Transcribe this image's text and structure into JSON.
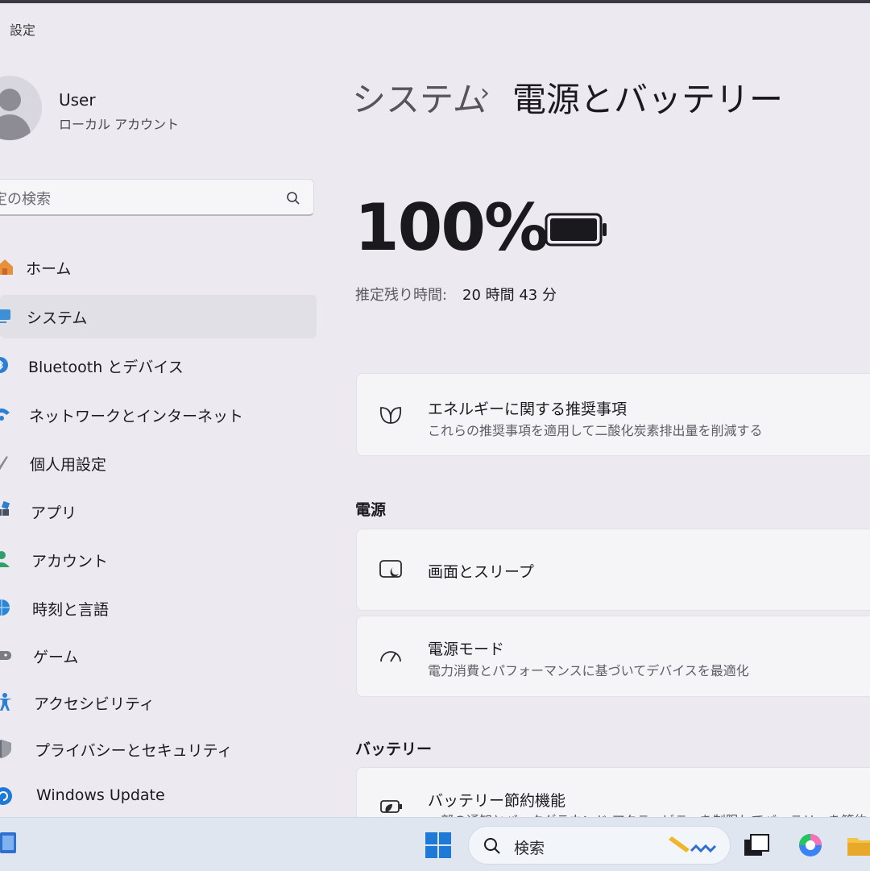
{
  "app_title": "設定",
  "user": {
    "name": "User",
    "account_type": "ローカル アカウント"
  },
  "search": {
    "placeholder": "定の検索"
  },
  "nav": [
    {
      "label": "ホーム",
      "icon": "home-icon"
    },
    {
      "label": "システム",
      "icon": "system-icon",
      "active": true
    },
    {
      "label": "Bluetooth とデバイス",
      "icon": "bluetooth-icon"
    },
    {
      "label": "ネットワークとインターネット",
      "icon": "wifi-icon"
    },
    {
      "label": "個人用設定",
      "icon": "pen-icon"
    },
    {
      "label": "アプリ",
      "icon": "apps-icon"
    },
    {
      "label": "アカウント",
      "icon": "account-icon"
    },
    {
      "label": "時刻と言語",
      "icon": "globe-icon"
    },
    {
      "label": "ゲーム",
      "icon": "gamepad-icon"
    },
    {
      "label": "アクセシビリティ",
      "icon": "accessibility-icon"
    },
    {
      "label": "プライバシーとセキュリティ",
      "icon": "shield-icon"
    },
    {
      "label": "Windows Update",
      "icon": "update-icon"
    }
  ],
  "breadcrumb": {
    "parent": "システム",
    "separator": "›",
    "current": "電源とバッテリー"
  },
  "battery": {
    "percent": "100%",
    "level": 1.0,
    "estimate_label": "推定残り時間:",
    "estimate_value": "20 時間 43 分"
  },
  "energy_card": {
    "title": "エネルギーに関する推奨事項",
    "subtitle": "これらの推奨事項を適用して二酸化炭素排出量を削減する",
    "icon": "leaf-icon"
  },
  "power_section": {
    "heading": "電源",
    "items": [
      {
        "title": "画面とスリープ",
        "icon": "screen-sleep-icon"
      },
      {
        "title": "電源モード",
        "subtitle": "電力消費とパフォーマンスに基づいてデバイスを最適化",
        "icon": "gauge-icon"
      }
    ]
  },
  "battery_section": {
    "heading": "バッテリー",
    "items": [
      {
        "title": "バッテリー節約機能",
        "subtitle": "一部の通知とバックグラウンド アクティビティを制限してバッテリーを節約",
        "icon": "battery-saver-icon"
      }
    ]
  },
  "taskbar": {
    "search_label": "検索",
    "apps": [
      "task-view-icon",
      "copilot-icon",
      "file-explorer-icon"
    ]
  },
  "colors": {
    "background": "#eceaf0",
    "card": "#f5f4f7",
    "accent_blue": "#1e7ad6",
    "taskbar": "#dfe6f0"
  }
}
